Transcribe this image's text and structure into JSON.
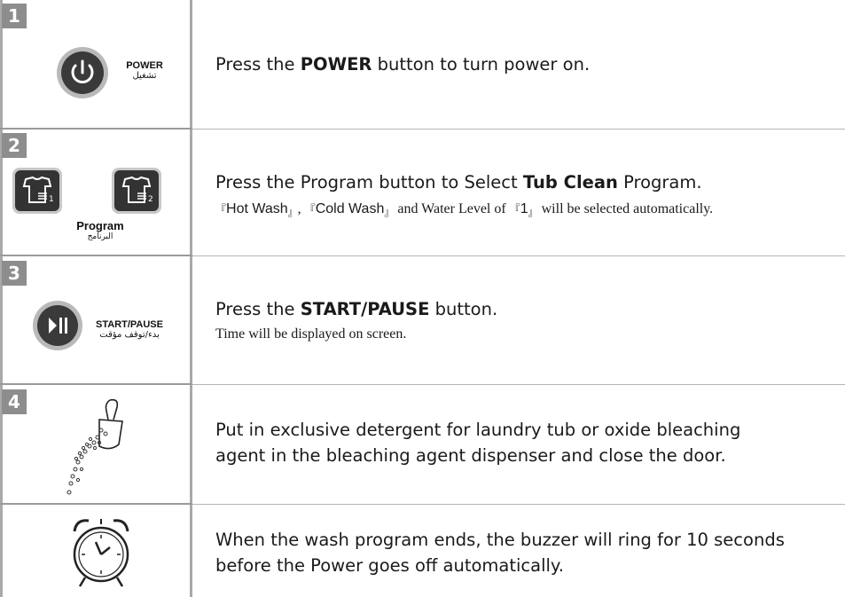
{
  "steps": [
    {
      "number": "1",
      "button_label": "POWER",
      "button_label_ar": "تشغيل",
      "icon": "power-icon",
      "text_before": "Press the ",
      "text_bold": "POWER",
      "text_after": " button to turn power on."
    },
    {
      "number": "2",
      "button_label": "Program",
      "button_label_ar": "البرنامج",
      "icon": "shirt-program-icon",
      "text_before": "Press the Program button to Select ",
      "text_bold": "Tub Clean",
      "text_after": " Program.",
      "sub": {
        "br_open": "『",
        "hot": "Hot Wash",
        "br_close": "』",
        "comma": ",",
        "cold": "Cold Wash",
        "mid": " and Water Level of ",
        "level": "1",
        "end": " will be selected automatically."
      }
    },
    {
      "number": "3",
      "button_label": "START/PAUSE",
      "button_label_ar": "بدء/توقف مؤقت",
      "icon": "play-pause-icon",
      "text_before": "Press the ",
      "text_bold": "START/PAUSE",
      "text_after": " button.",
      "sub_text": "Time will be displayed on screen."
    },
    {
      "number": "4",
      "icon": "detergent-scoop-icon",
      "line1": "Put in exclusive detergent for laundry tub or oxide bleaching",
      "line2": "agent in the bleaching agent dispenser and close the door."
    },
    {
      "icon": "alarm-clock-icon",
      "line1": "When the wash program ends, the buzzer will ring for 10 seconds",
      "line2": "before the Power goes off automatically."
    }
  ],
  "colors": {
    "badge": "#8d8d8d",
    "button_dark": "#3a3a3a",
    "divider": "#9a9a9a"
  }
}
